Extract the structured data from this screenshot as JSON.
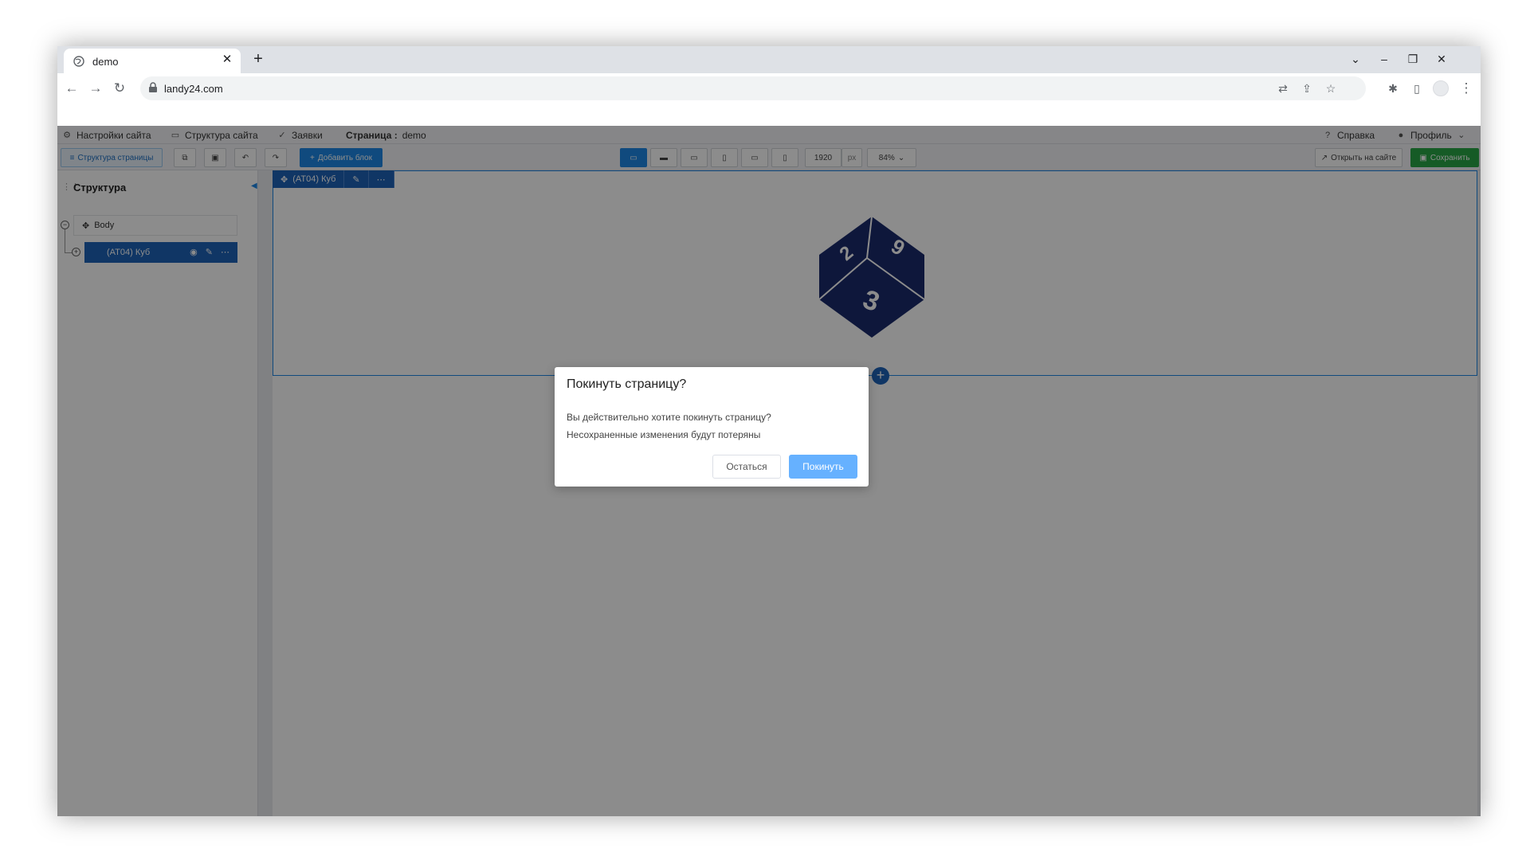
{
  "browser": {
    "tab_title": "demo",
    "tab_close": "✕",
    "new_tab": "+",
    "url": "landy24.com",
    "window_controls": {
      "list": "⌄",
      "minimize": "–",
      "restore": "❐",
      "close": "✕"
    },
    "nav": {
      "back": "←",
      "forward": "→",
      "reload": "↻"
    },
    "omnibox_icons": {
      "translate": "⇄",
      "share": "⇪",
      "bookmark": "☆",
      "extensions": "✱",
      "sidepanel": "▯",
      "menu": "⋮"
    }
  },
  "app": {
    "topbar": {
      "site_settings": "Настройки сайта",
      "site_structure": "Структура сайта",
      "requests": "Заявки",
      "page_label": "Страница :",
      "page_name": "demo",
      "help": "Справка",
      "profile": "Профиль"
    },
    "toolbar": {
      "page_structure": "Структура страницы",
      "add_block": "Добавить блок",
      "width_value": "1920",
      "width_unit": "px",
      "zoom": "84%",
      "open_on_site": "Открыть на сайте",
      "save": "Сохранить"
    },
    "sidebar": {
      "title": "Структура",
      "body_node": "Body",
      "cube_node": "(AT04) Куб"
    },
    "block": {
      "label": "(AT04) Куб",
      "dice_faces": [
        "3",
        "9",
        "2"
      ]
    }
  },
  "modal": {
    "title": "Покинуть страницу?",
    "line1": "Вы действительно хотите покинуть страницу?",
    "line2": "Несохраненные изменения будут потеряны",
    "stay_button": "Остаться",
    "leave_button": "Покинуть"
  },
  "colors": {
    "accent": "#1e88e5",
    "dice": "#1a2a6c",
    "save_green": "#28a745",
    "leave_button": "#66b1ff"
  }
}
